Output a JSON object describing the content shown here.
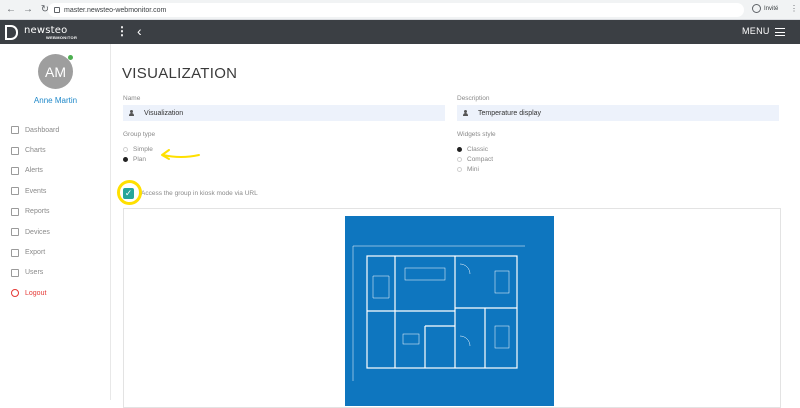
{
  "browser": {
    "url": "master.newsteo-webmonitor.com",
    "profile_label": "Invité"
  },
  "topbar": {
    "logo_name": "newsteo",
    "logo_sub": "WEBMONITOR",
    "menu_label": "MENU",
    "kebab_glyph": "⋮",
    "back_glyph": "‹"
  },
  "sidebar": {
    "avatar_initials": "AM",
    "user_name": "Anne Martin",
    "items": [
      {
        "label": "Dashboard",
        "icon": "monitor-icon"
      },
      {
        "label": "Charts",
        "icon": "chart-icon"
      },
      {
        "label": "Alerts",
        "icon": "bell-icon"
      },
      {
        "label": "Events",
        "icon": "paperclip-icon"
      },
      {
        "label": "Reports",
        "icon": "book-icon"
      },
      {
        "label": "Devices",
        "icon": "grid-icon"
      },
      {
        "label": "Export",
        "icon": "cloud-icon"
      },
      {
        "label": "Users",
        "icon": "user-icon"
      },
      {
        "label": "Logout",
        "icon": "power-icon"
      }
    ]
  },
  "main": {
    "title": "VISUALIZATION",
    "name_label": "Name",
    "name_value": "Visualization",
    "description_label": "Description",
    "description_value": "Temperature display",
    "group_type_label": "Group type",
    "group_type_options": [
      "Simple",
      "Plan"
    ],
    "group_type_selected": "Plan",
    "widgets_style_label": "Widgets style",
    "widgets_style_options": [
      "Classic",
      "Compact",
      "Mini"
    ],
    "widgets_style_selected": "Classic",
    "kiosk_label": "Access the group in kiosk mode via URL",
    "kiosk_checked": true
  },
  "colors": {
    "topbar": "#3b3f44",
    "accent_blue": "#1e88c9",
    "checkbox_teal": "#26a69a",
    "logout_red": "#e53935",
    "annotation_yellow": "#ffe000",
    "plan_blue": "#0e76bf"
  }
}
